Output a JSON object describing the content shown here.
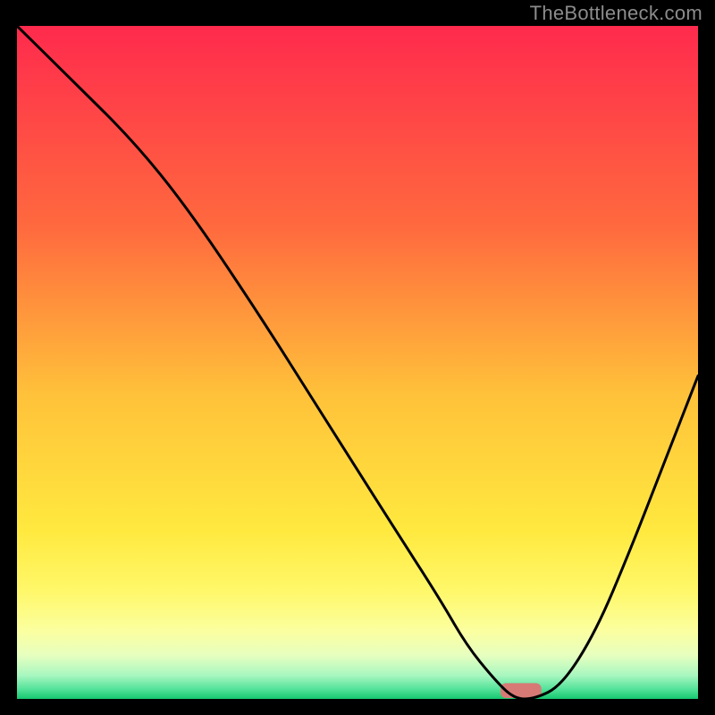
{
  "watermark": "TheBottleneck.com",
  "chart_data": {
    "type": "line",
    "title": "",
    "xlabel": "",
    "ylabel": "",
    "xlim": [
      0,
      100
    ],
    "ylim": [
      0,
      100
    ],
    "grid": false,
    "legend": false,
    "background_gradient_stops": [
      {
        "offset": 0.0,
        "color": "#ff2a4d"
      },
      {
        "offset": 0.3,
        "color": "#ff6a3e"
      },
      {
        "offset": 0.55,
        "color": "#ffc23a"
      },
      {
        "offset": 0.75,
        "color": "#ffe93f"
      },
      {
        "offset": 0.84,
        "color": "#fff86a"
      },
      {
        "offset": 0.9,
        "color": "#fbffa0"
      },
      {
        "offset": 0.935,
        "color": "#e7ffbf"
      },
      {
        "offset": 0.965,
        "color": "#a8f7c0"
      },
      {
        "offset": 0.985,
        "color": "#56e39b"
      },
      {
        "offset": 1.0,
        "color": "#15c76f"
      }
    ],
    "series": [
      {
        "name": "bottleneck-curve",
        "x": [
          0,
          8,
          17,
          25,
          35,
          45,
          55,
          62,
          66,
          70,
          73,
          76,
          80,
          85,
          90,
          95,
          100
        ],
        "y": [
          100,
          92,
          83,
          73,
          58,
          42,
          26,
          15,
          8,
          3,
          0,
          0,
          2,
          10,
          22,
          35,
          48
        ]
      }
    ],
    "marker": {
      "name": "optimal-range",
      "x_center": 74,
      "width": 6,
      "color": "#d77a75",
      "height": 2.2
    }
  }
}
